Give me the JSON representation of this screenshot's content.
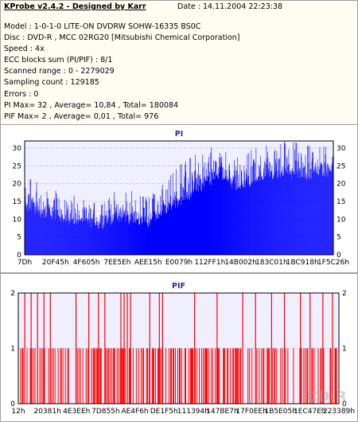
{
  "header": {
    "title": "KProbe v2.4.2 - Designed by Karr",
    "date": "Date : 14.11.2004 22:23:38",
    "lines": [
      "Model : 1-0-1-0 LITE-ON DVDRW SOHW-16335 BS0C",
      "Disc : DVD-R , MCC 02RG20  [Mitsubishi Chemical Corporation]",
      "Speed : 4x",
      "ECC blocks sum (PI/PIF) : 8/1",
      "Scanned range : 0 - 2279029",
      "Sampling count : 129185",
      "Errors : 0",
      "PI Max= 32 , Average= 10,84 , Total= 180084",
      "PIF Max= 2 , Average= 0,01 , Total= 976"
    ]
  },
  "watermark": {
    "text": "CD-R",
    "url": "www.cdr.cz"
  },
  "colors": {
    "pi": "#0000ff",
    "pif": "#ff0000",
    "plot_bg": "#efefff",
    "grid": "#c0c0e0"
  },
  "chart_data": [
    {
      "type": "bar",
      "title": "PI",
      "ylim": [
        0,
        32
      ],
      "yticks": [
        0,
        5,
        10,
        15,
        20,
        25,
        30
      ],
      "xticks": [
        "7Dh",
        "20F45h",
        "4F605h",
        "7EE5Eh",
        "AEE15h",
        "E0079h",
        "112FF1h",
        "14B002h",
        "183C01h",
        "1BC918h",
        "1F5C26h"
      ],
      "grid": "horizontal dashed",
      "profile": {
        "x": [
          0,
          0.05,
          0.1,
          0.15,
          0.2,
          0.25,
          0.3,
          0.35,
          0.4,
          0.45,
          0.5,
          0.55,
          0.6,
          0.63,
          0.66,
          0.7,
          0.75,
          0.8,
          0.85,
          0.9,
          0.95,
          1.0
        ],
        "base": [
          12,
          11,
          10,
          9,
          8.5,
          8,
          10,
          9,
          8.5,
          11,
          14,
          17,
          20,
          22,
          20,
          18,
          20,
          21,
          22,
          21,
          22,
          23
        ],
        "peak": [
          22,
          20,
          18,
          17,
          15,
          14,
          18,
          17,
          16,
          20,
          25,
          28,
          30,
          31,
          28,
          27,
          30,
          31,
          32,
          31,
          30,
          32
        ]
      }
    },
    {
      "type": "bar",
      "title": "PIF",
      "ylim": [
        0,
        2
      ],
      "yticks": [
        0,
        1,
        2
      ],
      "xticks": [
        "12h",
        "20381h",
        "4E3EEh",
        "7D855h",
        "AE4F6h",
        "DE1F5h",
        "111394h",
        "147BE7h",
        "17F0EEh",
        "1B5E05h",
        "1EC47Eh",
        "223389h"
      ],
      "grid": "horizontal dashed",
      "spikes": {
        "two": [
          0.02,
          0.04,
          0.06,
          0.08,
          0.1,
          0.18,
          0.22,
          0.25,
          0.27,
          0.32,
          0.33,
          0.34,
          0.35,
          0.41,
          0.44,
          0.45,
          0.55,
          0.62,
          0.7,
          0.74,
          0.79,
          0.83,
          0.88,
          0.91,
          0.95,
          0.98
        ],
        "one_density": 0.45
      }
    }
  ]
}
